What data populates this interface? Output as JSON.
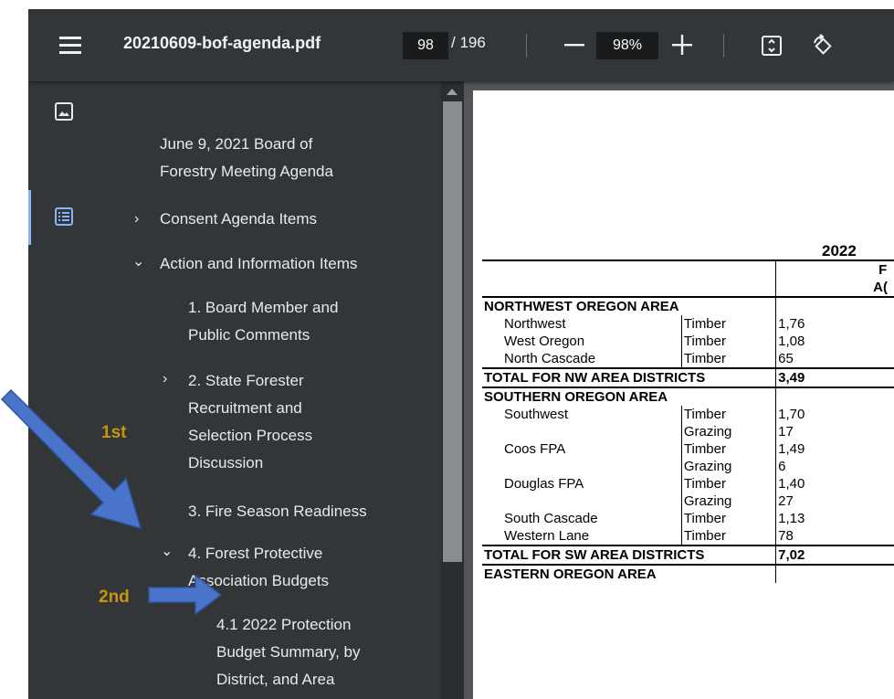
{
  "toolbar": {
    "title": "20210609-bof-agenda.pdf",
    "page_current": "98",
    "page_total": "/ 196",
    "zoom": "98%"
  },
  "outline": {
    "root": "June 9, 2021 Board of Forestry Meeting Agenda",
    "root_lines": [
      "June 9, 2021 Board of",
      "Forestry Meeting Agenda"
    ],
    "consent": "Consent Agenda Items",
    "action": "Action and Information Items",
    "item1_lines": [
      "1. Board Member and",
      "Public Comments"
    ],
    "item2_lines": [
      "2. State Forester",
      "Recruitment and",
      "Selection Process",
      "Discussion"
    ],
    "item3": "3. Fire Season Readiness",
    "item4_lines": [
      "4. Forest Protective",
      "Association Budgets"
    ],
    "item41_lines": [
      "4.1 2022 Protection",
      "Budget Summary, by",
      "District, and Area"
    ]
  },
  "annotations": {
    "first": "1st",
    "second": "2nd"
  },
  "document": {
    "title_fragment": "2022",
    "header_fragments": [
      "F",
      "A("
    ],
    "rows": [
      {
        "c1": "NORTHWEST OREGON AREA",
        "c2": "",
        "c3": "",
        "kind": "area"
      },
      {
        "c1": "Northwest",
        "c2": "Timber",
        "c3": "1,76",
        "kind": "row"
      },
      {
        "c1": "West Oregon",
        "c2": "Timber",
        "c3": "1,08",
        "kind": "row"
      },
      {
        "c1": "North Cascade",
        "c2": "Timber",
        "c3": "65",
        "kind": "row"
      },
      {
        "c1": "TOTAL FOR NW AREA DISTRICTS",
        "c2": "",
        "c3": "3,49",
        "kind": "total"
      },
      {
        "c1": "SOUTHERN OREGON AREA",
        "c2": "",
        "c3": "",
        "kind": "area"
      },
      {
        "c1": "Southwest",
        "c2": "Timber",
        "c3": "1,70",
        "kind": "row"
      },
      {
        "c1": "",
        "c2": "Grazing",
        "c3": "17",
        "kind": "row"
      },
      {
        "c1": "Coos FPA",
        "c2": "Timber",
        "c3": "1,49",
        "kind": "row"
      },
      {
        "c1": "",
        "c2": "Grazing",
        "c3": "6",
        "kind": "row"
      },
      {
        "c1": "Douglas FPA",
        "c2": "Timber",
        "c3": "1,40",
        "kind": "row"
      },
      {
        "c1": "",
        "c2": "Grazing",
        "c3": "27",
        "kind": "row"
      },
      {
        "c1": "South Cascade",
        "c2": "Timber",
        "c3": "1,13",
        "kind": "row"
      },
      {
        "c1": "Western Lane",
        "c2": "Timber",
        "c3": "78",
        "kind": "row"
      },
      {
        "c1": "TOTAL FOR SW AREA DISTRICTS",
        "c2": "",
        "c3": "7,02",
        "kind": "total"
      },
      {
        "c1": "EASTERN OREGON AREA",
        "c2": "",
        "c3": "",
        "kind": "area"
      }
    ]
  }
}
